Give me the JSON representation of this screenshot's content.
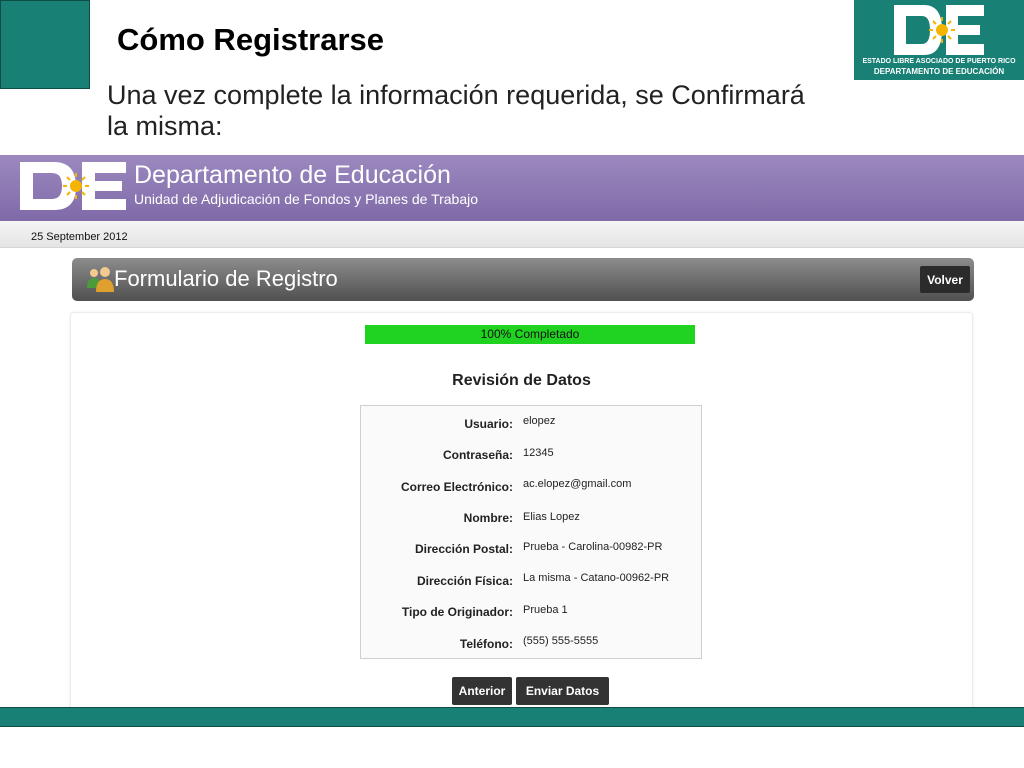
{
  "slide": {
    "title": "Cómo Registrarse",
    "text": "Una vez complete la información requerida, se Confirmará la misma:",
    "logo": {
      "line1": "ESTADO LIBRE ASOCIADO DE PUERTO RICO",
      "line2": "DEPARTAMENTO DE EDUCACIÓN"
    }
  },
  "site": {
    "name": "Departamento de Educación",
    "subtitle": "Unidad de Adjudicación de Fondos y Planes de Trabajo",
    "date": "25 September 2012"
  },
  "form": {
    "title": "Formulario de Registro",
    "back_label": "Volver",
    "progress_label": "100% Completado",
    "progress_fraction": 1.0,
    "review_title": "Revisión de Datos",
    "fields": [
      {
        "label": "Usuario:",
        "value": "elopez"
      },
      {
        "label": "Contraseña:",
        "value": "12345"
      },
      {
        "label": "Correo Electrónico:",
        "value": "ac.elopez@gmail.com"
      },
      {
        "label": "Nombre:",
        "value": "Elias Lopez"
      },
      {
        "label": "Dirección Postal:",
        "value": "Prueba - Carolina-00982-PR"
      },
      {
        "label": "Dirección Física:",
        "value": "La misma - Catano-00962-PR"
      },
      {
        "label": "Tipo de Originador:",
        "value": "Prueba 1"
      },
      {
        "label": "Teléfono:",
        "value": "(555) 555-5555"
      }
    ],
    "prev_label": "Anterior",
    "submit_label": "Enviar Datos"
  },
  "colors": {
    "teal": "#188075",
    "header_purple": "#8f7bb5",
    "progress_green": "#21d321"
  },
  "icons": {
    "logo": "de-logo",
    "form": "users-icon"
  }
}
